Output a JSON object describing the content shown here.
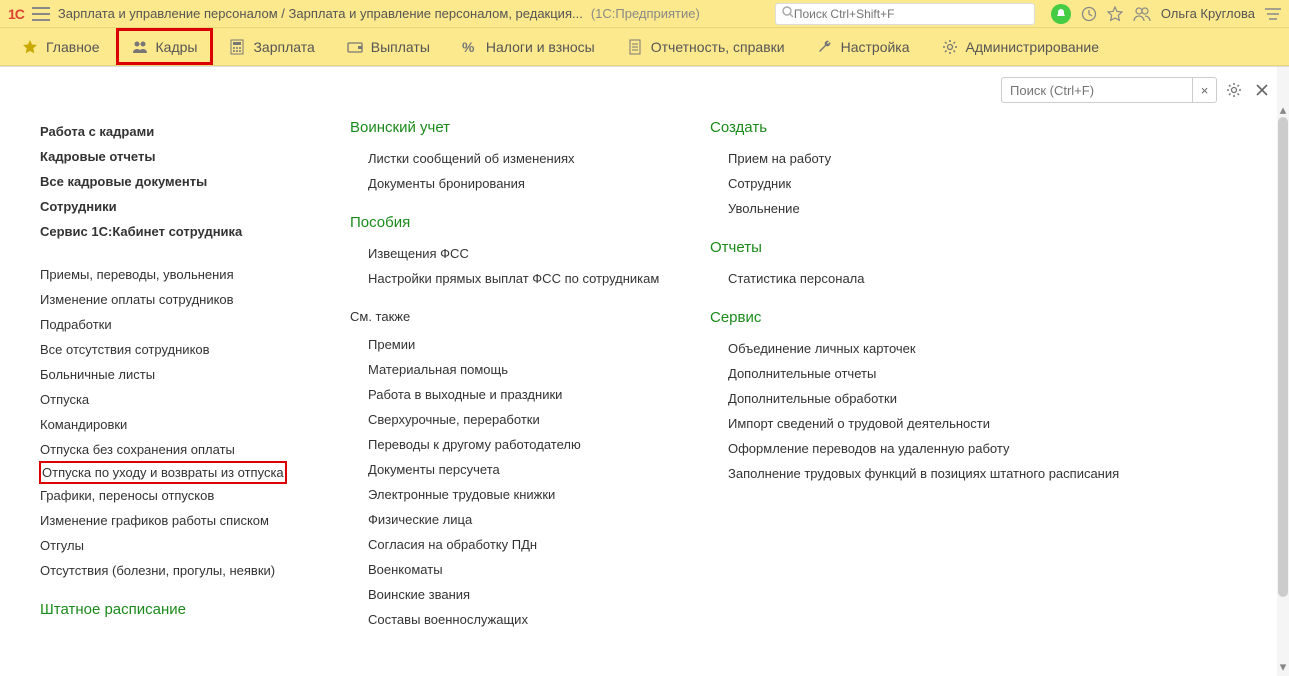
{
  "title_bar": {
    "logo": "1C",
    "app_title": "Зарплата и управление персоналом / Зарплата и управление персоналом, редакция...",
    "context": "(1С:Предприятие)",
    "search_placeholder": "Поиск Ctrl+Shift+F",
    "user_name": "Ольга Круглова"
  },
  "nav": [
    {
      "icon": "star",
      "label": "Главное"
    },
    {
      "icon": "people",
      "label": "Кадры",
      "highlighted": true
    },
    {
      "icon": "calc",
      "label": "Зарплата"
    },
    {
      "icon": "wallet",
      "label": "Выплаты"
    },
    {
      "icon": "percent",
      "label": "Налоги и взносы"
    },
    {
      "icon": "doc",
      "label": "Отчетность, справки"
    },
    {
      "icon": "wrench",
      "label": "Настройка"
    },
    {
      "icon": "gear",
      "label": "Администрирование"
    }
  ],
  "panel": {
    "search_placeholder": "Поиск (Ctrl+F)",
    "clear": "×"
  },
  "col1": {
    "group1": [
      "Работа с кадрами",
      "Кадровые отчеты",
      "Все кадровые документы",
      "Сотрудники",
      "Сервис 1С:Кабинет сотрудника"
    ],
    "group2": [
      "Приемы, переводы, увольнения",
      "Изменение оплаты сотрудников",
      "Подработки",
      "Все отсутствия сотрудников",
      "Больничные листы",
      "Отпуска",
      "Командировки",
      "Отпуска без сохранения оплаты",
      "Отпуска по уходу и возвраты из отпуска",
      "Графики, переносы отпусков",
      "Изменение графиков работы списком",
      "Отгулы",
      "Отсутствия (болезни, прогулы, неявки)"
    ],
    "footer_head": "Штатное расписание"
  },
  "col2": {
    "sec1_head": "Воинский учет",
    "sec1_items": [
      "Листки сообщений об изменениях",
      "Документы бронирования"
    ],
    "sec2_head": "Пособия",
    "sec2_items": [
      "Извещения ФСС",
      "Настройки прямых выплат ФСС по сотрудникам"
    ],
    "sec3_head": "См. также",
    "sec3_items": [
      "Премии",
      "Материальная помощь",
      "Работа в выходные и праздники",
      "Сверхурочные, переработки",
      "Переводы к другому работодателю",
      "Документы персучета",
      "Электронные трудовые книжки",
      "Физические лица",
      "Согласия на обработку ПДн",
      "Военкоматы",
      "Воинские звания",
      "Составы военнослужащих"
    ]
  },
  "col3": {
    "sec1_head": "Создать",
    "sec1_items": [
      "Прием на работу",
      "Сотрудник",
      "Увольнение"
    ],
    "sec2_head": "Отчеты",
    "sec2_items": [
      "Статистика персонала"
    ],
    "sec3_head": "Сервис",
    "sec3_items": [
      "Объединение личных карточек",
      "Дополнительные отчеты",
      "Дополнительные обработки",
      "Импорт сведений о трудовой деятельности",
      "Оформление переводов на удаленную работу",
      "Заполнение трудовых функций в позициях штатного расписания"
    ]
  }
}
